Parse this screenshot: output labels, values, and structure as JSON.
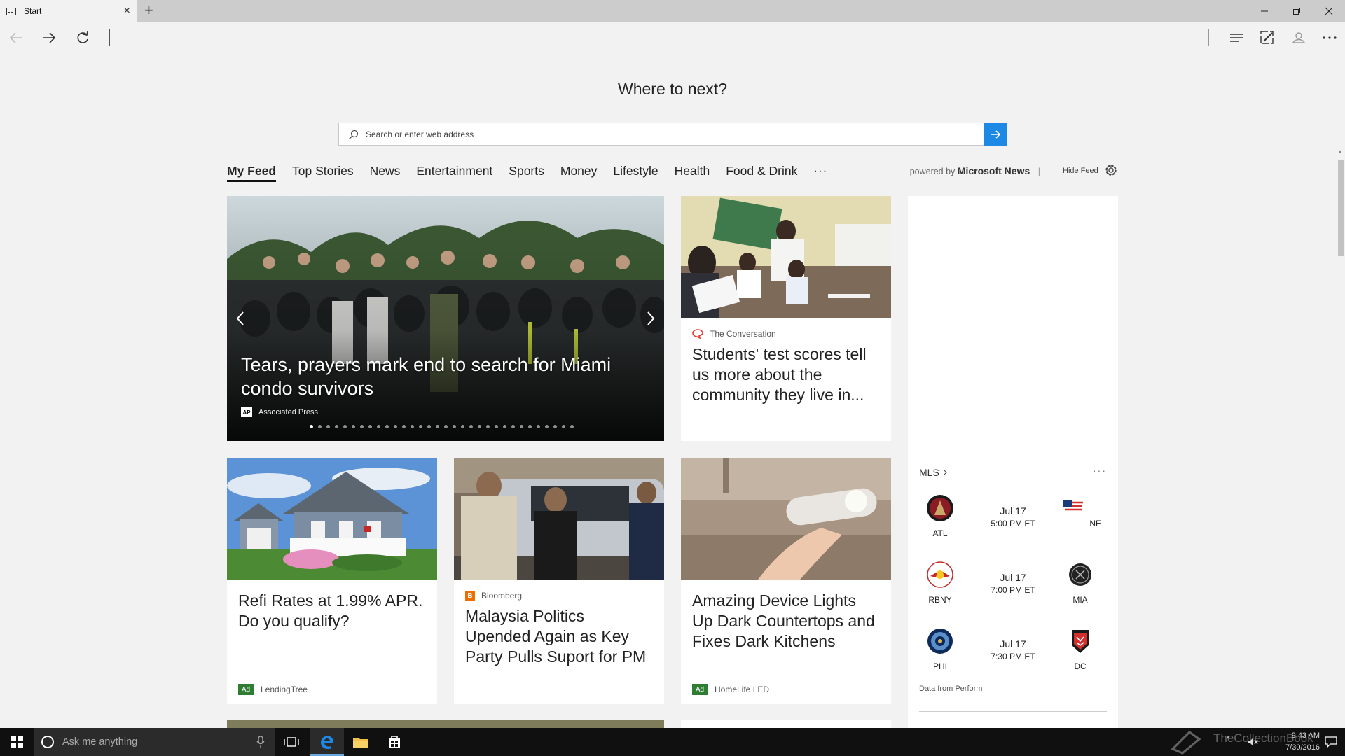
{
  "browser": {
    "tab_title": "Start",
    "tab_close": "×",
    "new_tab": "+"
  },
  "start_page": {
    "heading": "Where to next?",
    "search_placeholder": "Search or enter web address"
  },
  "feed": {
    "tabs": [
      "My Feed",
      "Top Stories",
      "News",
      "Entertainment",
      "Sports",
      "Money",
      "Lifestyle",
      "Health",
      "Food & Drink"
    ],
    "more": "···",
    "powered_prefix": "powered by",
    "powered_brand": "Microsoft News",
    "separator": "|",
    "hide_feed": "Hide Feed"
  },
  "hero": {
    "title": "Tears, prayers mark end to search for Miami condo survivors",
    "source": "Associated Press",
    "source_badge": "AP",
    "dot_count": 32,
    "active_dot": 0
  },
  "cards": [
    {
      "source": "The Conversation",
      "title": "Students' test scores tell us more about the community they live in..."
    },
    {
      "ad": "Ad",
      "source": "LendingTree",
      "title": "Refi Rates at 1.99% APR. Do you qualify?"
    },
    {
      "source": "Bloomberg",
      "source_badge": "B",
      "title": "Malaysia Politics Upended Again as Key Party Pulls Suport for PM"
    },
    {
      "ad": "Ad",
      "source": "HomeLife LED",
      "title": "Amazing Device Lights Up Dark Countertops and Fixes Dark Kitchens"
    }
  ],
  "mls": {
    "title": "MLS",
    "more": "···",
    "matches": [
      {
        "home": "ATL",
        "away": "NE",
        "date": "Jul 17",
        "time": "5:00 PM ET"
      },
      {
        "home": "RBNY",
        "away": "MIA",
        "date": "Jul 17",
        "time": "7:00 PM ET"
      },
      {
        "home": "PHI",
        "away": "DC",
        "date": "Jul 17",
        "time": "7:30 PM ET"
      }
    ],
    "credit": "Data from Perform"
  },
  "taskbar": {
    "search_placeholder": "Ask me anything",
    "time": "9:43 AM",
    "date": "7/30/2016",
    "watermark": "TheCollectionBook"
  },
  "colors": {
    "accent": "#1e88e5",
    "ad_badge": "#2e7d32",
    "conversation": "#e53935",
    "bloomberg": "#ef6c00",
    "taskbar": "#101010"
  }
}
